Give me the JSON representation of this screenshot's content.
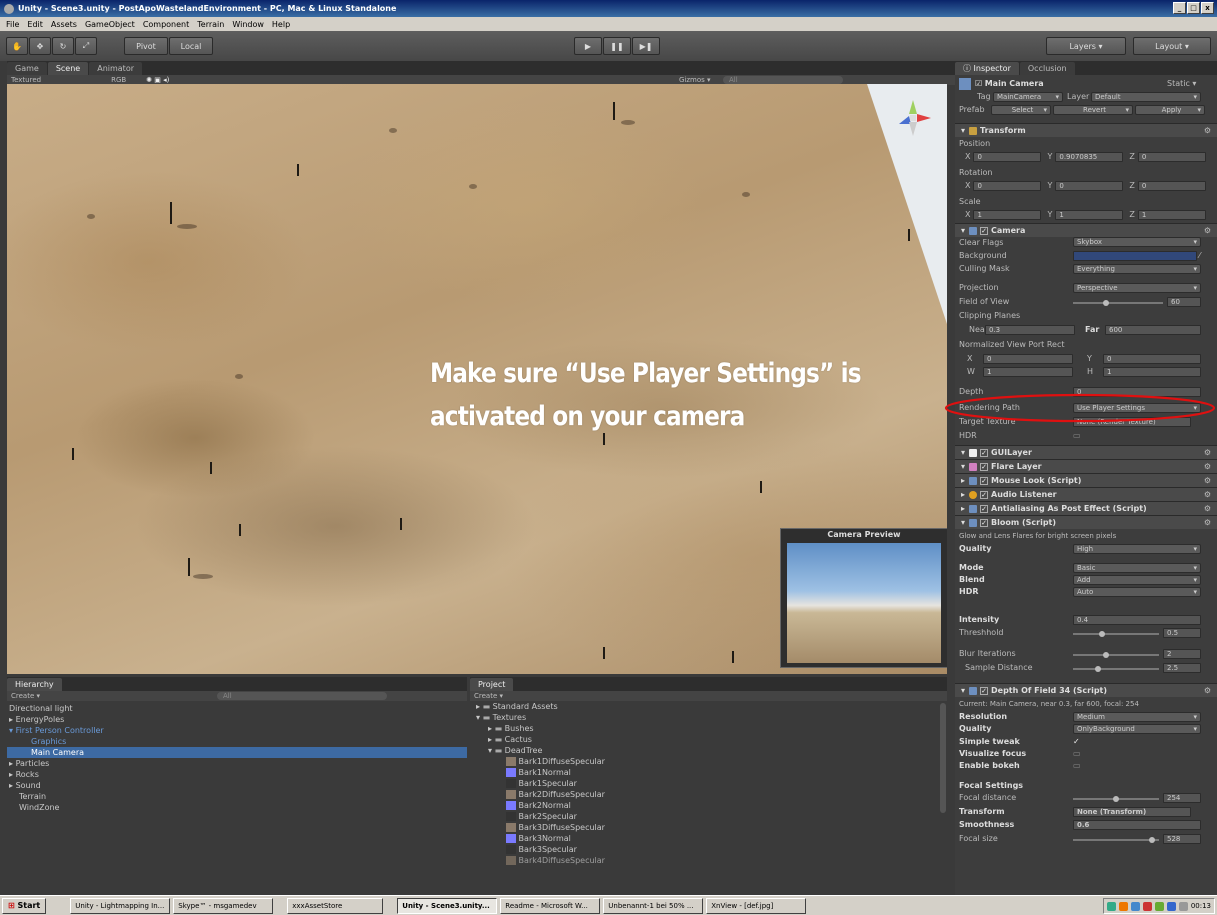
{
  "window": {
    "title": "Unity - Scene3.unity - PostApoWastelandEnvironment - PC, Mac & Linux Standalone",
    "controls": [
      "_",
      "□",
      "x"
    ]
  },
  "menu": [
    "File",
    "Edit",
    "Assets",
    "GameObject",
    "Component",
    "Terrain",
    "Window",
    "Help"
  ],
  "toolbar": {
    "pivot": "Pivot",
    "local": "Local",
    "layers": "Layers",
    "layout": "Layout"
  },
  "scene_tabs": {
    "game": "Game",
    "scene": "Scene",
    "animator": "Animator"
  },
  "scene_bar": {
    "textured": "Textured",
    "rgb": "RGB",
    "gizmos": "Gizmos ▾",
    "search": "All"
  },
  "overlay": {
    "line1": "Make sure “Use Player Settings” is",
    "line2": "activated on your camera"
  },
  "camera_preview": {
    "title": "Camera Preview"
  },
  "inspector": {
    "tab": "Inspector",
    "tab2": "Occlusion",
    "object_name": "Main Camera",
    "static": "Static ▾",
    "tag_label": "Tag",
    "tag": "MainCamera",
    "layer_label": "Layer",
    "layer": "Default",
    "prefab_label": "Prefab",
    "prefab_select": "Select",
    "prefab_revert": "Revert",
    "prefab_apply": "Apply",
    "transform": {
      "title": "Transform",
      "position": "Position",
      "rotation": "Rotation",
      "scale": "Scale",
      "pos": {
        "x": "0",
        "y": "0.9070835",
        "z": "0"
      },
      "rot": {
        "x": "0",
        "y": "0",
        "z": "0"
      },
      "scl": {
        "x": "1",
        "y": "1",
        "z": "1"
      }
    },
    "camera": {
      "title": "Camera",
      "clear_flags_label": "Clear Flags",
      "clear_flags": "Skybox",
      "background_label": "Background",
      "culling_label": "Culling Mask",
      "culling": "Everything",
      "projection_label": "Projection",
      "projection": "Perspective",
      "fov_label": "Field of View",
      "fov": "60",
      "clipping_label": "Clipping Planes",
      "near_label": "Near",
      "near": "0.3",
      "far_label": "Far",
      "far": "600",
      "viewport_label": "Normalized View Port Rect",
      "vx": "0",
      "vy": "0",
      "vw": "1",
      "vh": "1",
      "depth_label": "Depth",
      "depth": "0",
      "rendering_label": "Rendering Path",
      "rendering": "Use Player Settings",
      "target_label": "Target Texture",
      "target": "None (Render Texture)",
      "hdr_label": "HDR"
    },
    "components": [
      "GUILayer",
      "Flare Layer",
      "Mouse Look (Script)",
      "Audio Listener",
      "Antialiasing As Post Effect (Script)",
      "Bloom (Script)"
    ],
    "bloom": {
      "desc": "Glow and Lens Flares for bright screen pixels",
      "quality_label": "Quality",
      "quality": "High",
      "mode_label": "Mode",
      "mode": "Basic",
      "blend_label": "Blend",
      "blend": "Add",
      "hdr_label": "HDR",
      "hdr": "Auto",
      "intensity_label": "Intensity",
      "intensity": "0.4",
      "threshold_label": "Threshhold",
      "threshold": "0.5",
      "blur_label": "Blur Iterations",
      "blur": "2",
      "sample_label": "Sample Distance",
      "sample": "2.5"
    },
    "dof": {
      "title": "Depth Of Field 34 (Script)",
      "desc": "Current: Main Camera, near 0.3, far 600, focal: 254",
      "resolution_label": "Resolution",
      "resolution": "Medium",
      "quality_label": "Quality",
      "quality": "OnlyBackground",
      "simple_label": "Simple tweak",
      "visualize_label": "Visualize focus",
      "bokeh_label": "Enable bokeh",
      "focal_settings": "Focal Settings",
      "focal_dist_label": "Focal distance",
      "focal_dist": "254",
      "transform_label": "Transform",
      "transform": "None (Transform)",
      "smooth_label": "Smoothness",
      "smooth": "0.6",
      "focal_size_label": "Focal size",
      "focal_size": "528"
    }
  },
  "hierarchy": {
    "tab": "Hierarchy",
    "create": "Create ▾",
    "search": "All",
    "items": [
      "Directional light",
      "EnergyPoles",
      "First Person Controller",
      "Graphics",
      "Main Camera",
      "Particles",
      "Rocks",
      "Sound",
      "Terrain",
      "WindZone"
    ]
  },
  "project": {
    "tab": "Project",
    "create": "Create ▾",
    "items": [
      "Standard Assets",
      "Textures",
      "Bushes",
      "Cactus",
      "DeadTree",
      "Bark1DiffuseSpecular",
      "Bark1Normal",
      "Bark1Specular",
      "Bark2DiffuseSpecular",
      "Bark2Normal",
      "Bark2Specular",
      "Bark3DiffuseSpecular",
      "Bark3Normal",
      "Bark3Specular",
      "Bark4DiffuseSpecular"
    ]
  },
  "taskbar": {
    "start": "Start",
    "buttons": [
      "Unity - Lightmapping In...",
      "Skype™ - msgamedev",
      "xxxAssetStore",
      "Unity - Scene3.unity...",
      "Readme - Microsoft W...",
      "Unbenannt-1 bei 50% ...",
      "XnView - [def.jpg]"
    ],
    "clock": "00:13"
  },
  "colors": {
    "highlight": "#e01010",
    "selection": "#3d6aa3"
  }
}
